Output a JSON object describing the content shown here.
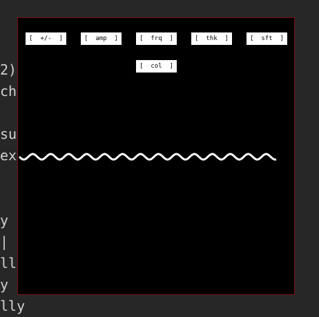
{
  "background_text": {
    "lines": [
      "2)",
      "ch",
      "su",
      "ex",
      "y",
      "|",
      "lly",
      "y",
      "lly"
    ]
  },
  "sketch": {
    "controls": [
      {
        "id": "amplitude-sign",
        "label": "[  +/-  ]"
      },
      {
        "id": "amplitude",
        "label": "[  amp  ]"
      },
      {
        "id": "frequency",
        "label": "[  frq  ]"
      },
      {
        "id": "thickness",
        "label": "[  thk  ]"
      },
      {
        "id": "shift",
        "label": "[  sft  ]"
      },
      {
        "id": "color",
        "label": "[  col  ]"
      }
    ],
    "wave": {
      "color": "#ffffff",
      "background": "#000000"
    }
  },
  "colors": {
    "editor_background": "#272727",
    "window_border": "#7a1212",
    "button_background": "#ffffff"
  }
}
